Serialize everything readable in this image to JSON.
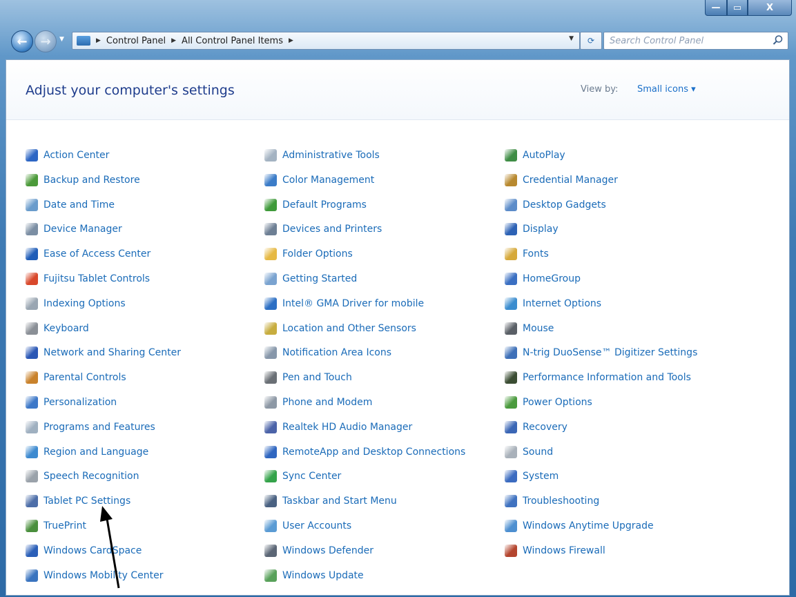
{
  "window": {
    "caption_minimize": "—",
    "caption_maximize": "▭",
    "caption_close": "X"
  },
  "nav": {
    "breadcrumb": [
      "Control Panel",
      "All Control Panel Items"
    ],
    "search_placeholder": "Search Control Panel"
  },
  "header": {
    "title": "Adjust your computer's settings",
    "view_by_label": "View by:",
    "view_by_value": "Small icons ▾"
  },
  "columns": [
    [
      {
        "label": "Action Center",
        "icon": "action-center-icon",
        "color": "#2d66c4"
      },
      {
        "label": "Backup and Restore",
        "icon": "backup-restore-icon",
        "color": "#4c9a3a"
      },
      {
        "label": "Date and Time",
        "icon": "date-time-icon",
        "color": "#6a9ccc"
      },
      {
        "label": "Device Manager",
        "icon": "device-manager-icon",
        "color": "#7b8ea3"
      },
      {
        "label": "Ease of Access Center",
        "icon": "ease-of-access-icon",
        "color": "#1f5db8"
      },
      {
        "label": "Fujitsu Tablet Controls",
        "icon": "fujitsu-tablet-icon",
        "color": "#d9482b"
      },
      {
        "label": "Indexing Options",
        "icon": "indexing-options-icon",
        "color": "#9aa6b2"
      },
      {
        "label": "Keyboard",
        "icon": "keyboard-icon",
        "color": "#8a8f96"
      },
      {
        "label": "Network and Sharing Center",
        "icon": "network-sharing-icon",
        "color": "#2a57b5"
      },
      {
        "label": "Parental Controls",
        "icon": "parental-controls-icon",
        "color": "#c9822b"
      },
      {
        "label": "Personalization",
        "icon": "personalization-icon",
        "color": "#3d78c8"
      },
      {
        "label": "Programs and Features",
        "icon": "programs-features-icon",
        "color": "#9fb0c0"
      },
      {
        "label": "Region and Language",
        "icon": "region-language-icon",
        "color": "#3d8ad0"
      },
      {
        "label": "Speech Recognition",
        "icon": "speech-recognition-icon",
        "color": "#9aa2aa"
      },
      {
        "label": "Tablet PC Settings",
        "icon": "tablet-pc-icon",
        "color": "#4d6ea8"
      },
      {
        "label": "TruePrint",
        "icon": "trueprint-icon",
        "color": "#4a8f3d"
      },
      {
        "label": "Windows CardSpace",
        "icon": "cardspace-icon",
        "color": "#2b5fb8"
      },
      {
        "label": "Windows Mobility Center",
        "icon": "mobility-center-icon",
        "color": "#3a74bf"
      }
    ],
    [
      {
        "label": "Administrative Tools",
        "icon": "administrative-tools-icon",
        "color": "#a4b3c2"
      },
      {
        "label": "Color Management",
        "icon": "color-management-icon",
        "color": "#3b7cc8"
      },
      {
        "label": "Default Programs",
        "icon": "default-programs-icon",
        "color": "#3f9a3a"
      },
      {
        "label": "Devices and Printers",
        "icon": "devices-printers-icon",
        "color": "#6d7f94"
      },
      {
        "label": "Folder Options",
        "icon": "folder-options-icon",
        "color": "#e6b944"
      },
      {
        "label": "Getting Started",
        "icon": "getting-started-icon",
        "color": "#7aa3d0"
      },
      {
        "label": "Intel® GMA Driver for mobile",
        "icon": "intel-gma-icon",
        "color": "#2c6fc4"
      },
      {
        "label": "Location and Other Sensors",
        "icon": "location-sensors-icon",
        "color": "#c7ad3f"
      },
      {
        "label": "Notification Area Icons",
        "icon": "notification-area-icon",
        "color": "#8797aa"
      },
      {
        "label": "Pen and Touch",
        "icon": "pen-touch-icon",
        "color": "#6a6f75"
      },
      {
        "label": "Phone and Modem",
        "icon": "phone-modem-icon",
        "color": "#8d98a5"
      },
      {
        "label": "Realtek HD Audio Manager",
        "icon": "realtek-audio-icon",
        "color": "#4b63a8"
      },
      {
        "label": "RemoteApp and Desktop Connections",
        "icon": "remoteapp-icon",
        "color": "#2f66c0"
      },
      {
        "label": "Sync Center",
        "icon": "sync-center-icon",
        "color": "#34a34a"
      },
      {
        "label": "Taskbar and Start Menu",
        "icon": "taskbar-start-icon",
        "color": "#4a6282"
      },
      {
        "label": "User Accounts",
        "icon": "user-accounts-icon",
        "color": "#5a9bd4"
      },
      {
        "label": "Windows Defender",
        "icon": "windows-defender-icon",
        "color": "#5b6675"
      },
      {
        "label": "Windows Update",
        "icon": "windows-update-icon",
        "color": "#58a15a"
      }
    ],
    [
      {
        "label": "AutoPlay",
        "icon": "autoplay-icon",
        "color": "#3f8d45"
      },
      {
        "label": "Credential Manager",
        "icon": "credential-manager-icon",
        "color": "#b8892f"
      },
      {
        "label": "Desktop Gadgets",
        "icon": "desktop-gadgets-icon",
        "color": "#5c8cc9"
      },
      {
        "label": "Display",
        "icon": "display-icon",
        "color": "#2d62b5"
      },
      {
        "label": "Fonts",
        "icon": "fonts-icon",
        "color": "#d6a93a"
      },
      {
        "label": "HomeGroup",
        "icon": "homegroup-icon",
        "color": "#3a6fc2"
      },
      {
        "label": "Internet Options",
        "icon": "internet-options-icon",
        "color": "#3b8dcf"
      },
      {
        "label": "Mouse",
        "icon": "mouse-icon",
        "color": "#5a5f66"
      },
      {
        "label": "N-trig DuoSense™ Digitizer Settings",
        "icon": "ntrig-digitizer-icon",
        "color": "#3e70b8"
      },
      {
        "label": "Performance Information and Tools",
        "icon": "performance-tools-icon",
        "color": "#3b4d33"
      },
      {
        "label": "Power Options",
        "icon": "power-options-icon",
        "color": "#4a9a3d"
      },
      {
        "label": "Recovery",
        "icon": "recovery-icon",
        "color": "#3a66b5"
      },
      {
        "label": "Sound",
        "icon": "sound-icon",
        "color": "#a9b1ba"
      },
      {
        "label": "System",
        "icon": "system-icon",
        "color": "#3b6bc0"
      },
      {
        "label": "Troubleshooting",
        "icon": "troubleshooting-icon",
        "color": "#3f72c0"
      },
      {
        "label": "Windows Anytime Upgrade",
        "icon": "anytime-upgrade-icon",
        "color": "#4d8fd0"
      },
      {
        "label": "Windows Firewall",
        "icon": "windows-firewall-icon",
        "color": "#b4452e"
      }
    ]
  ]
}
